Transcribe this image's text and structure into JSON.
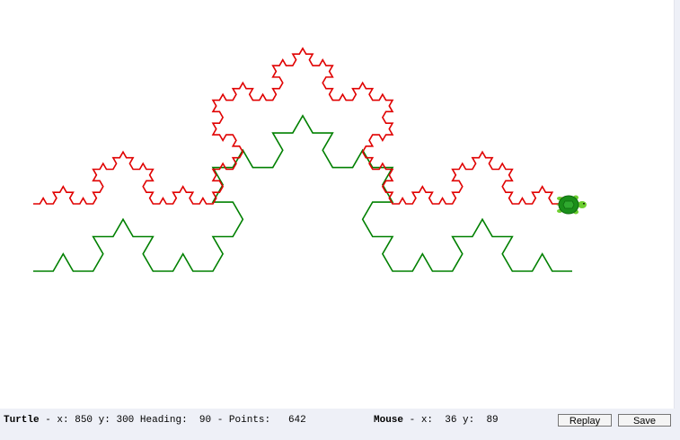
{
  "status": {
    "turtle_label": "Turtle",
    "turtle_x_label": "- x:",
    "turtle_x": "850",
    "turtle_y_label": "y:",
    "turtle_y": "300",
    "heading_label": "Heading:",
    "heading": "90",
    "points_label": "- Points:",
    "points": "642",
    "mouse_label": "Mouse",
    "mouse_x_label": "- x:",
    "mouse_x": "36",
    "mouse_y_label": "y:",
    "mouse_y": "89"
  },
  "buttons": {
    "replay_label": "Replay",
    "save_label": "Save"
  },
  "drawing": {
    "curves": [
      {
        "name": "koch-level-3",
        "color": "#008000",
        "order": 3
      },
      {
        "name": "koch-level-4",
        "color": "#e00000",
        "order": 4
      }
    ],
    "turtle_icon": "turtle-icon",
    "turtle_colors": {
      "shell": "#1a8f1a",
      "body": "#6ccf2f"
    }
  }
}
